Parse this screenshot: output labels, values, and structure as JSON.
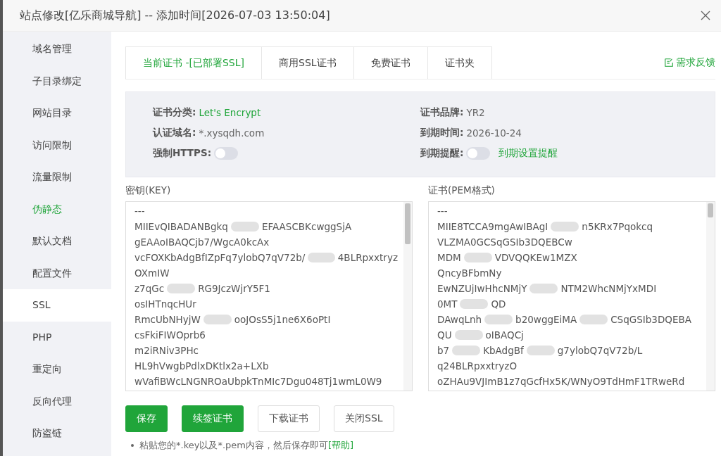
{
  "window": {
    "title": "站点修改[亿乐商城导航] -- 添加时间[2026-07-03 13:50:04]"
  },
  "sidebar": {
    "items": [
      {
        "label": "域名管理",
        "selected": false,
        "highlighted": false
      },
      {
        "label": "子目录绑定",
        "selected": false,
        "highlighted": false
      },
      {
        "label": "网站目录",
        "selected": false,
        "highlighted": false
      },
      {
        "label": "访问限制",
        "selected": false,
        "highlighted": false
      },
      {
        "label": "流量限制",
        "selected": false,
        "highlighted": false
      },
      {
        "label": "伪静态",
        "selected": false,
        "highlighted": true
      },
      {
        "label": "默认文档",
        "selected": false,
        "highlighted": false
      },
      {
        "label": "配置文件",
        "selected": false,
        "highlighted": false
      },
      {
        "label": "SSL",
        "selected": true,
        "highlighted": false
      },
      {
        "label": "PHP",
        "selected": false,
        "highlighted": false
      },
      {
        "label": "重定向",
        "selected": false,
        "highlighted": false
      },
      {
        "label": "反向代理",
        "selected": false,
        "highlighted": false
      },
      {
        "label": "防盗链",
        "selected": false,
        "highlighted": false
      }
    ]
  },
  "tabs": [
    {
      "label": "当前证书 -[已部署SSL]",
      "selected": true
    },
    {
      "label": "商用SSL证书",
      "selected": false
    },
    {
      "label": "免费证书",
      "selected": false
    },
    {
      "label": "证书夹",
      "selected": false
    }
  ],
  "feedback_link": "需求反馈",
  "info": {
    "left": [
      {
        "label": "证书分类:",
        "value": "Let's Encrypt",
        "kind": "link"
      },
      {
        "label": "认证域名:",
        "value": "*.xysqdh.com",
        "kind": "text"
      },
      {
        "label": "强制HTTPS:",
        "on": false,
        "kind": "toggle"
      }
    ],
    "right": [
      {
        "label": "证书品牌:",
        "value": "YR2",
        "kind": "text"
      },
      {
        "label": "到期时间:",
        "value": "2026-10-24",
        "kind": "text"
      },
      {
        "label": "到期提醒:",
        "on": false,
        "value": "到期设置提醒",
        "kind": "toggle"
      }
    ]
  },
  "key_box": {
    "label": "密钥(KEY)",
    "lines": [
      [
        "---"
      ],
      [
        "MIIEvQIBADANBgkq",
        "EFAASCBKcwggSjA"
      ],
      [
        "gEAAoIBAQCjb7/WgcA0kcAx"
      ],
      [
        "vcFOXKbAdgBfIZpFq7ylobQ7qV72b/",
        "4BLRpxxtryz"
      ],
      [
        "OXmIW"
      ],
      [
        "z7qGc",
        "RG9JczWjrY5F1"
      ],
      [
        "osIHTnqcHUr"
      ],
      [
        "RmcUbNHyjW",
        "ooJOsS5j1ne6X6oPtI"
      ],
      [
        "csFkiFIWOprb6"
      ],
      [
        "m2iRNiv3PHc"
      ],
      [
        "HL9hVwgbPdlxDKtlx2a+LXb"
      ],
      [
        "wVafiBWcLNGNROaUbpkTnMIc7Dgu048Tj1wmL0W9"
      ]
    ]
  },
  "cert_box": {
    "label": "证书(PEM格式)",
    "lines": [
      [
        "---"
      ],
      [
        "MIIE8TCCA9mgAwIBAgI",
        "n5KRx7Pqokcq"
      ],
      [
        "VLZMA0GCSqGSIb3DQEBCw"
      ],
      [
        "MDM",
        "VDVQQKEw1MZX"
      ],
      [
        "QncyBFbmNy"
      ],
      [
        "EwNZUjIwHhcNMjY",
        "NTM2WhcNMjYxMDI"
      ],
      [
        "0MT",
        "QD"
      ],
      [
        "DAwqLnh",
        "b20wggEiMA",
        "CSqGSIb3DQEBA"
      ],
      [
        "QU",
        "oIBAQCj"
      ],
      [
        "b7",
        "KbAdgBf",
        "g7ylobQ7qV72b/L"
      ],
      [
        "q24BLRpxxtryzO"
      ],
      [
        "oZHAu9VJImB1z7qGcfHx5K/WNyO9TdHmF1TRweRd"
      ]
    ]
  },
  "buttons": [
    {
      "label": "保存",
      "kind": "primary"
    },
    {
      "label": "续签证书",
      "kind": "primary"
    },
    {
      "label": "下载证书",
      "kind": "default"
    },
    {
      "label": "关闭SSL",
      "kind": "default"
    }
  ],
  "hint": {
    "text": "粘贴您的*.key以及*.pem内容，然后保存即可",
    "link": "[帮助]"
  }
}
